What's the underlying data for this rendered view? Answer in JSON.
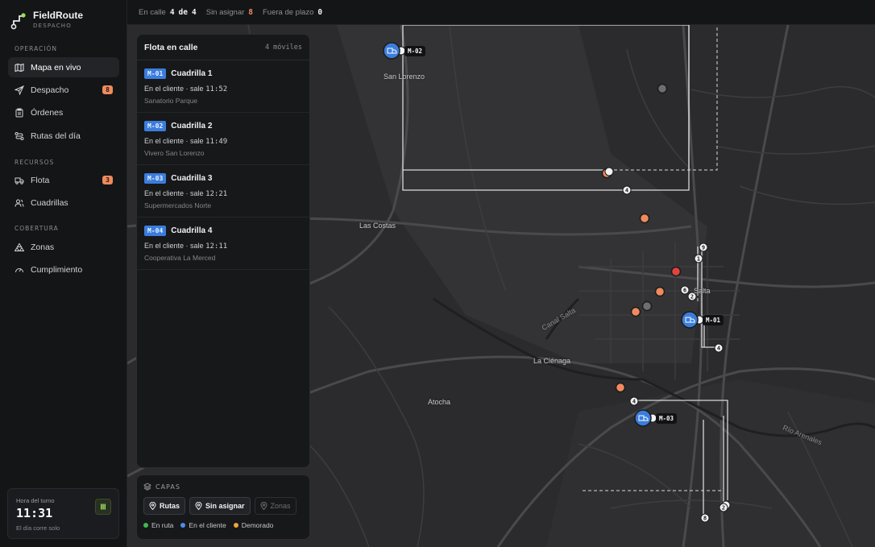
{
  "brand": {
    "name": "FieldRoute",
    "subtitle": "DESPACHO"
  },
  "sidebar": {
    "sections": [
      {
        "label": "OPERACIÓN"
      },
      {
        "label": "RECURSOS"
      },
      {
        "label": "COBERTURA"
      }
    ],
    "items": [
      {
        "label": "Mapa en vivo",
        "icon": "map-icon"
      },
      {
        "label": "Despacho",
        "icon": "send-icon",
        "badge": "8"
      },
      {
        "label": "Órdenes",
        "icon": "clipboard-icon"
      },
      {
        "label": "Rutas del día",
        "icon": "route-icon"
      },
      {
        "label": "Flota",
        "icon": "truck-icon",
        "badge": "3"
      },
      {
        "label": "Cuadrillas",
        "icon": "users-icon"
      },
      {
        "label": "Zonas",
        "icon": "zones-icon"
      },
      {
        "label": "Cumplimiento",
        "icon": "gauge-icon"
      }
    ],
    "shift": {
      "label": "Hora del turno",
      "time": "11:31",
      "note": "El día corre solo"
    }
  },
  "topbar": {
    "on_street_label": "En calle",
    "on_street_value": "4",
    "on_street_of": "de",
    "on_street_total": "4",
    "unassigned_label": "Sin asignar",
    "unassigned_value": "8",
    "overdue_label": "Fuera de plazo",
    "overdue_value": "0"
  },
  "fleet": {
    "title": "Flota en calle",
    "count": "4 móviles",
    "items": [
      {
        "unit": "M-01",
        "crew": "Cuadrilla 1",
        "status": "En el cliente · sale",
        "time": "11:52",
        "location": "Sanatorio Parque"
      },
      {
        "unit": "M-02",
        "crew": "Cuadrilla 2",
        "status": "En el cliente · sale",
        "time": "11:49",
        "location": "Vivero San Lorenzo"
      },
      {
        "unit": "M-03",
        "crew": "Cuadrilla 3",
        "status": "En el cliente · sale",
        "time": "12:21",
        "location": "Supermercados Norte"
      },
      {
        "unit": "M-04",
        "crew": "Cuadrilla 4",
        "status": "En el cliente · sale",
        "time": "12:11",
        "location": "Cooperativa La Merced"
      }
    ]
  },
  "layers": {
    "title": "CAPAS",
    "buttons": [
      {
        "label": "Rutas",
        "active": true
      },
      {
        "label": "Sin asignar",
        "active": true
      },
      {
        "label": "Zonas",
        "active": false
      }
    ],
    "legend": [
      {
        "label": "En ruta",
        "color": "#3fb950"
      },
      {
        "label": "En el cliente",
        "color": "#4a8ef0"
      },
      {
        "label": "Demorado",
        "color": "#f0a43a"
      }
    ]
  },
  "map": {
    "places": [
      "San Lorenzo",
      "Las Costas",
      "La Ciénaga",
      "Atocha",
      "Salta",
      "Canal Salta",
      "Río Arenales"
    ],
    "units": [
      "M-01",
      "M-02",
      "M-03"
    ],
    "stops": [
      "1",
      "2",
      "4",
      "6",
      "8",
      "9"
    ]
  },
  "colors": {
    "accent": "#3b7ddd",
    "warning": "#f08a5d",
    "alert": "#e0443c",
    "unassigned": "#f08a5d"
  }
}
